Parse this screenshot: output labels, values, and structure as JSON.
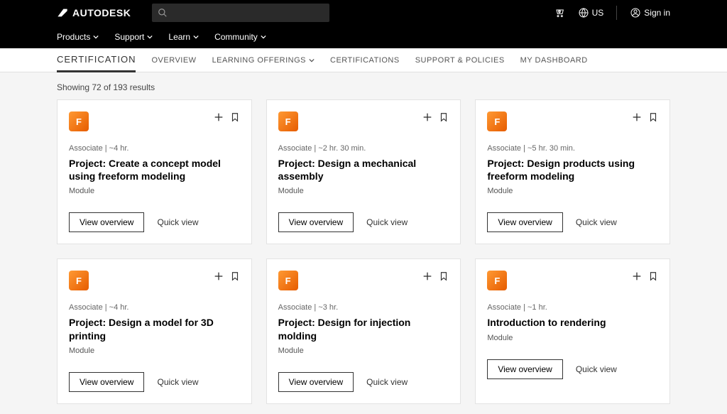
{
  "header": {
    "brand": "AUTODESK",
    "search_placeholder": "",
    "region": "US",
    "sign_in": "Sign in"
  },
  "secondary_nav": {
    "items": [
      "Products",
      "Support",
      "Learn",
      "Community"
    ]
  },
  "tertiary_nav": {
    "title": "CERTIFICATION",
    "items": [
      "OVERVIEW",
      "LEARNING OFFERINGS",
      "CERTIFICATIONS",
      "SUPPORT & POLICIES",
      "MY DASHBOARD"
    ]
  },
  "results": {
    "text": "Showing 72 of 193 results"
  },
  "common": {
    "product_badge": "F",
    "view_overview": "View overview",
    "quick_view": "Quick view"
  },
  "cards": [
    {
      "meta": "Associate | ~4 hr.",
      "title": "Project: Create a concept model using freeform modeling",
      "type": "Module"
    },
    {
      "meta": "Associate | ~2 hr. 30 min.",
      "title": "Project: Design a mechanical assembly",
      "type": "Module"
    },
    {
      "meta": "Associate | ~5 hr. 30 min.",
      "title": "Project: Design products using freeform modeling",
      "type": "Module"
    },
    {
      "meta": "Associate | ~4 hr.",
      "title": "Project: Design a model for 3D printing",
      "type": "Module"
    },
    {
      "meta": "Associate | ~3 hr.",
      "title": "Project: Design for injection molding",
      "type": "Module"
    },
    {
      "meta": "Associate | ~1 hr.",
      "title": "Introduction to rendering",
      "type": "Module"
    }
  ]
}
